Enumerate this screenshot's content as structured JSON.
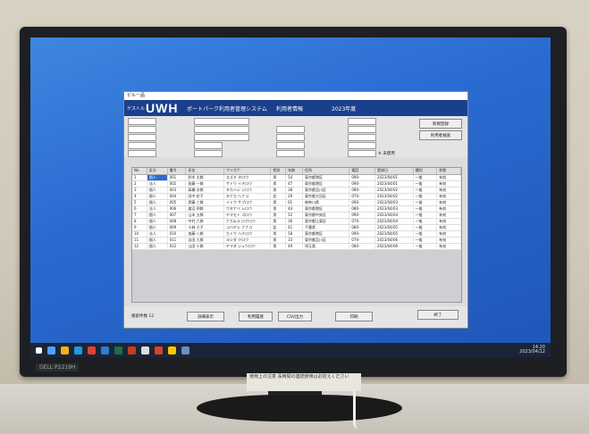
{
  "window": {
    "titlebar": "ビルー品",
    "header_small": "ゲストル",
    "logo": "UWH",
    "system_name": "ボートパーク利用者管理システム",
    "mode": "利用者情報",
    "year": "2023年度"
  },
  "form": {
    "right_buttons": [
      "新規登録",
      "利用者検索"
    ],
    "hint": "※ 未使用"
  },
  "grid": {
    "columns": [
      "No",
      "区分",
      "番号",
      "氏名",
      "フリガナ",
      "性別",
      "年齢",
      "住所",
      "電話",
      "登録日",
      "種別",
      "状態"
    ],
    "rows": [
      [
        "1",
        "個人",
        "001",
        "鈴木 太郎",
        "スズキ タロウ",
        "男",
        "54",
        "東京都港区",
        "090-",
        "2023/04/01",
        "一般",
        "有効"
      ],
      [
        "2",
        "法人",
        "002",
        "佐藤 一郎",
        "サトウ イチロウ",
        "男",
        "47",
        "東京都港区",
        "090-",
        "2023/04/01",
        "一般",
        "有効"
      ],
      [
        "3",
        "個人",
        "003",
        "高橋 次郎",
        "タカハシ ジロウ",
        "男",
        "38",
        "東京都品川区",
        "080-",
        "2023/04/02",
        "一般",
        "有効"
      ],
      [
        "4",
        "個人",
        "004",
        "田中 花子",
        "タナカ ハナコ",
        "女",
        "29",
        "東京都大田区",
        "070-",
        "2023/04/02",
        "一般",
        "有効"
      ],
      [
        "5",
        "個人",
        "005",
        "伊藤 三郎",
        "イトウ サブロウ",
        "男",
        "61",
        "神奈川県",
        "090-",
        "2023/04/03",
        "一般",
        "有効"
      ],
      [
        "6",
        "法人",
        "006",
        "渡辺 四郎",
        "ワタナベ シロウ",
        "男",
        "44",
        "東京都港区",
        "080-",
        "2023/04/03",
        "一般",
        "有効"
      ],
      [
        "7",
        "個人",
        "007",
        "山本 五郎",
        "ヤマモト ゴロウ",
        "男",
        "52",
        "東京都中央区",
        "090-",
        "2023/04/04",
        "一般",
        "有効"
      ],
      [
        "8",
        "個人",
        "008",
        "中村 六郎",
        "ナカムラ ロクロウ",
        "男",
        "36",
        "東京都江東区",
        "070-",
        "2023/04/04",
        "一般",
        "有効"
      ],
      [
        "9",
        "個人",
        "009",
        "小林 七子",
        "コバヤシ ナナコ",
        "女",
        "41",
        "千葉県",
        "080-",
        "2023/04/05",
        "一般",
        "有効"
      ],
      [
        "10",
        "法人",
        "010",
        "加藤 八郎",
        "カトウ ハチロウ",
        "男",
        "58",
        "東京都港区",
        "090-",
        "2023/04/05",
        "一般",
        "有効"
      ],
      [
        "11",
        "個人",
        "011",
        "吉田 九郎",
        "ヨシダ クロウ",
        "男",
        "33",
        "東京都品川区",
        "070-",
        "2023/04/06",
        "一般",
        "有効"
      ],
      [
        "12",
        "個人",
        "012",
        "山田 十郎",
        "ヤマダ ジュウロウ",
        "男",
        "49",
        "埼玉県",
        "080-",
        "2023/04/06",
        "一般",
        "有効"
      ]
    ]
  },
  "footer": {
    "left": "検索件数 12",
    "buttons": [
      "詳細表示",
      "利用履歴",
      "CSV出力",
      "印刷",
      "終了"
    ]
  },
  "taskbar": {
    "time": "14:20",
    "date": "2023/04/12"
  },
  "bezel_label": "DELL P2219H",
  "sticker_text": "使用上の注意 長時間の連続使用はお控えください"
}
